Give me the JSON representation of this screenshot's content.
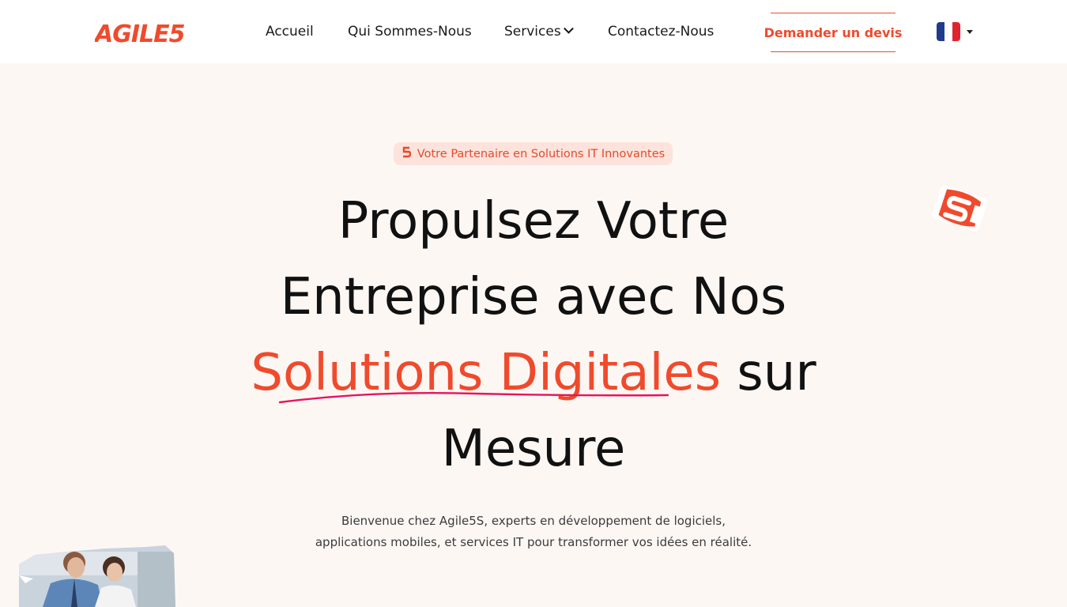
{
  "brand": {
    "name": "AGILE5"
  },
  "nav": {
    "items": [
      {
        "label": "Accueil"
      },
      {
        "label": "Qui Sommes-Nous"
      },
      {
        "label": "Services"
      },
      {
        "label": "Contactez-Nous"
      }
    ],
    "cta_label": "Demander un devis",
    "language_icon": "flag-fr-icon"
  },
  "hero": {
    "badge": "Votre Partenaire en Solutions IT Innovantes",
    "title_part1": "Propulsez Votre Entreprise avec Nos",
    "title_accent": "Solutions Digitales",
    "title_part2": "sur Mesure",
    "subtitle_line1": "Bienvenue chez Agile5S, experts en développement de logiciels,",
    "subtitle_line2": "applications mobiles, et services IT pour transformer vos idées en réalité."
  },
  "colors": {
    "accent": "#f04a2c",
    "underline": "#e8135a",
    "background": "#fdf7f4",
    "badge_bg": "#fde3dc"
  }
}
